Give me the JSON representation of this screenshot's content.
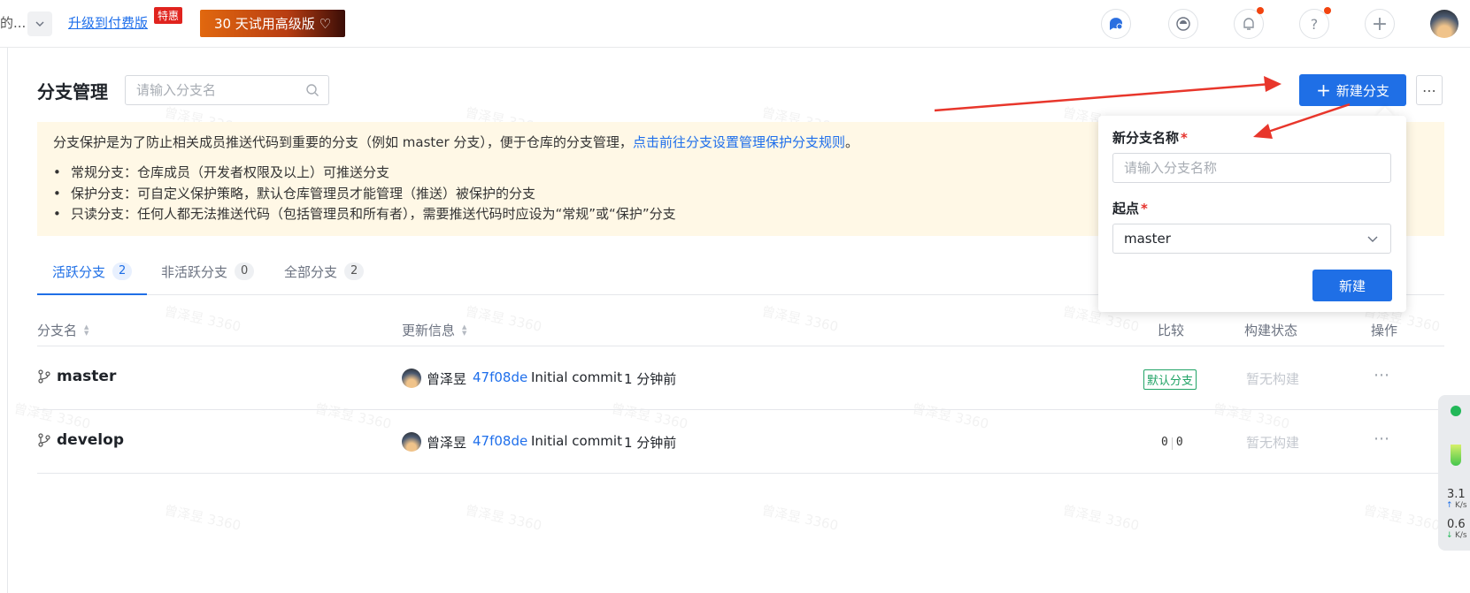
{
  "topbar": {
    "truncated_text": "的...",
    "upgrade_link": "升级到付费版",
    "special_badge": "特惠",
    "trial_button": "30 天试用高级版 ♡",
    "icons": [
      "chat-icon",
      "assistant-icon",
      "bell-icon",
      "help-icon",
      "plus-icon"
    ],
    "help_glyph": "?",
    "plus_glyph": "+"
  },
  "header": {
    "title": "分支管理",
    "search_placeholder": "请输入分支名",
    "new_branch_button": "新建分支",
    "new_branch_plus": "+",
    "more_glyph": "⋯"
  },
  "notice": {
    "text_before_link": "分支保护是为了防止相关成员推送代码到重要的分支（例如 master 分支），便于仓库的分支管理，",
    "link_text": "点击前往分支设置管理保护分支规则",
    "text_after_link": "。",
    "items": [
      "常规分支：仓库成员（开发者权限及以上）可推送分支",
      "保护分支：可自定义保护策略，默认仓库管理员才能管理（推送）被保护的分支",
      "只读分支：任何人都无法推送代码（包括管理员和所有者），需要推送代码时应设为“常规”或“保护”分支"
    ]
  },
  "tabs": [
    {
      "label": "活跃分支",
      "count": "2"
    },
    {
      "label": "非活跃分支",
      "count": "0"
    },
    {
      "label": "全部分支",
      "count": "2"
    }
  ],
  "table": {
    "columns": {
      "name": "分支名",
      "updated": "更新信息",
      "compare": "比较",
      "build": "构建状态",
      "actions": "操作"
    },
    "rows": [
      {
        "name": "master",
        "author": "曾泽昱",
        "sha": "47f08de",
        "message": "Initial commit",
        "time": "1 分钟前",
        "badge": "默认分支",
        "build": "暂无构建",
        "more": "⋯"
      },
      {
        "name": "develop",
        "author": "曾泽昱",
        "sha": "47f08de",
        "message": "Initial commit",
        "time": "1 分钟前",
        "behind": "0",
        "ahead": "0",
        "build": "暂无构建",
        "more": "⋯"
      }
    ]
  },
  "popover": {
    "name_label": "新分支名称",
    "required_mark": "*",
    "name_placeholder": "请输入分支名称",
    "source_label": "起点",
    "source_value": "master",
    "create_button": "新建"
  },
  "net_widget": {
    "up_value": "3.1",
    "up_unit": "K/s",
    "down_value": "0.6",
    "down_unit": "K/s"
  },
  "watermark_text": "曾泽昱 3360",
  "colors": {
    "primary": "#1f6fe6",
    "link": "#1f6feb",
    "notice_bg": "#fff8e6",
    "default_badge": "#21a366",
    "required": "#e5312b",
    "annotation_arrow": "#e8362b"
  }
}
